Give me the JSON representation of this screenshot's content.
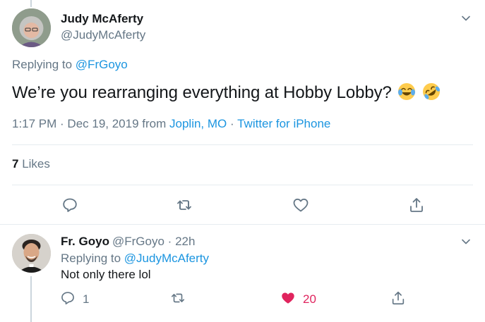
{
  "tweet": {
    "author_name": "Judy McAferty",
    "author_handle": "@JudyMcAferty",
    "replying_prefix": "Replying to",
    "replying_to": "@FrGoyo",
    "text": "We’re you rearranging everything at Hobby Lobby?",
    "emojis": [
      "joy-emoji",
      "rofl-emoji"
    ],
    "time": "1:17 PM · Dec 19, 2019 from",
    "location": "Joplin, MO",
    "separator": "·",
    "source": "Twitter for iPhone",
    "likes_count": "7",
    "likes_label": "Likes"
  },
  "reply": {
    "author_name": "Fr. Goyo",
    "author_handle": "@FrGoyo",
    "separator": "·",
    "time_ago": "22h",
    "replying_prefix": "Replying to",
    "replying_to": "@JudyMcAferty",
    "text": "Not only there lol",
    "reply_count": "1",
    "like_count": "20"
  },
  "colors": {
    "link": "#1b95e0",
    "secondary_text": "#657786",
    "liked_heart": "#e0245e",
    "divider": "#e6ecf0"
  },
  "icons": {
    "chevron": "chevron-down-icon",
    "reply": "reply-icon",
    "retweet": "retweet-icon",
    "like": "heart-icon",
    "share": "share-icon"
  }
}
